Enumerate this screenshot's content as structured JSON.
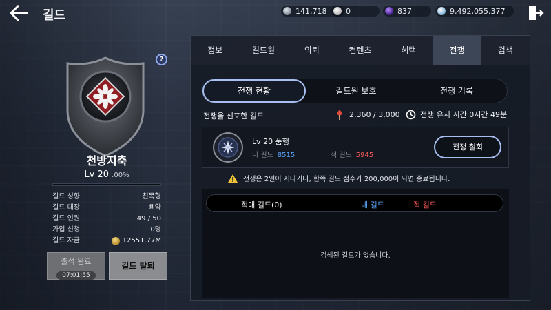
{
  "header": {
    "title": "길드",
    "currencies": [
      {
        "icon": "silver-coin-icon",
        "value": "141,718",
        "color": "#b9bfc9"
      },
      {
        "icon": "pearl-icon",
        "value": "0",
        "color": "#f0eef0"
      },
      {
        "icon": "purple-gem-icon",
        "value": "837",
        "color": "#7a43c8"
      },
      {
        "icon": "diamond-icon",
        "value": "9,492,055,377",
        "color": "#cfe3f3"
      }
    ]
  },
  "guild": {
    "name": "천방지축",
    "level": "Lv 20",
    "level_percent": ".00%",
    "level_progress": 0,
    "info": [
      {
        "key": "길드 성향",
        "value": "친목형"
      },
      {
        "key": "길드 대장",
        "value": "삐약"
      },
      {
        "key": "길드 인원",
        "value": "49 / 50"
      },
      {
        "key": "가입 신청",
        "value": "0명"
      },
      {
        "key": "길드 자금",
        "value": "12551.77M"
      }
    ],
    "attend_button": "출석 완료",
    "attend_timer": "07:01:55",
    "leave_button": "길드 탈퇴"
  },
  "tabs": [
    "정보",
    "길드원",
    "의뢰",
    "컨텐츠",
    "혜택",
    "전쟁",
    "검색"
  ],
  "active_tab": "전쟁",
  "war": {
    "subtabs": [
      "전쟁 현황",
      "길드원 보호",
      "전쟁 기록"
    ],
    "active_subtab": "전쟁 현황",
    "declared_label": "전쟁을 선포한 길드",
    "war_count": "2,360 / 3,000",
    "maintain_time": "전쟁 유지 시간 0시간 49분",
    "opponent": {
      "name": "Lv 20 품행",
      "my_label": "내 길드",
      "my_score": "8515",
      "enemy_label": "적 길드",
      "enemy_score": "5945",
      "retreat_button": "전쟁 철회"
    },
    "warning": "전쟁은 2일이 지나거나, 한쪽 길드 점수가 200,000이 되면 종료됩니다.",
    "list_headers": {
      "opponent": "적대 길드(0)",
      "my": "내 길드",
      "enemy": "적 길드"
    },
    "empty_message": "검색된 길드가 없습니다."
  },
  "colors": {
    "my_score": "#5aa8ff",
    "enemy_score": "#ff5a5a",
    "accent_border": "#a9bff2"
  }
}
